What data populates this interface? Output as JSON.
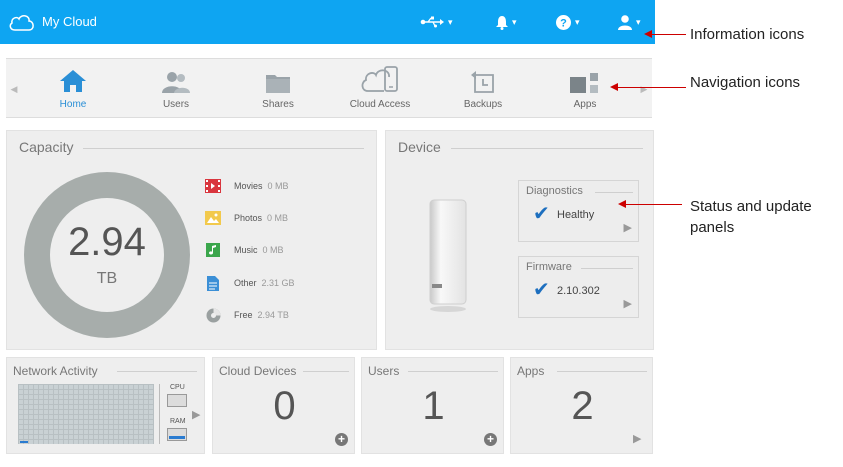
{
  "header": {
    "app_title": "My Cloud",
    "icons": [
      "usb-icon",
      "bell-icon",
      "help-icon",
      "user-icon"
    ]
  },
  "nav": {
    "items": [
      {
        "label": "Home",
        "icon": "home-icon",
        "active": true
      },
      {
        "label": "Users",
        "icon": "users-icon"
      },
      {
        "label": "Shares",
        "icon": "folder-icon"
      },
      {
        "label": "Cloud Access",
        "icon": "cloud-access-icon"
      },
      {
        "label": "Backups",
        "icon": "backup-icon"
      },
      {
        "label": "Apps",
        "icon": "apps-icon"
      }
    ]
  },
  "capacity": {
    "title": "Capacity",
    "total_value": "2.94",
    "total_unit": "TB",
    "legend": [
      {
        "label": "Movies",
        "value": "0 MB",
        "icon": "movies-icon",
        "color": "#d9363e"
      },
      {
        "label": "Photos",
        "value": "0 MB",
        "icon": "photos-icon",
        "color": "#f2c94c"
      },
      {
        "label": "Music",
        "value": "0 MB",
        "icon": "music-icon",
        "color": "#3aa64b"
      },
      {
        "label": "Other",
        "value": "2.31 GB",
        "icon": "other-icon",
        "color": "#3b8fd6"
      },
      {
        "label": "Free",
        "value": "2.94 TB",
        "icon": "free-icon",
        "color": "#9aa0a0"
      }
    ]
  },
  "device": {
    "title": "Device",
    "diagnostics": {
      "title": "Diagnostics",
      "status": "Healthy"
    },
    "firmware": {
      "title": "Firmware",
      "version": "2.10.302"
    }
  },
  "network": {
    "title": "Network Activity",
    "cpu_label": "CPU",
    "ram_label": "RAM"
  },
  "cloud_devices": {
    "title": "Cloud Devices",
    "count": "0"
  },
  "users": {
    "title": "Users",
    "count": "1"
  },
  "apps": {
    "title": "Apps",
    "count": "2"
  },
  "annotations": {
    "info_icons": "Information icons",
    "nav_icons": "Navigation icons",
    "status_panels": "Status and update panels"
  },
  "colors": {
    "accent": "#0ea5f2",
    "active_nav": "#2a8fd6",
    "check": "#1d6fbf",
    "annotation_arrow": "#cc0000"
  }
}
